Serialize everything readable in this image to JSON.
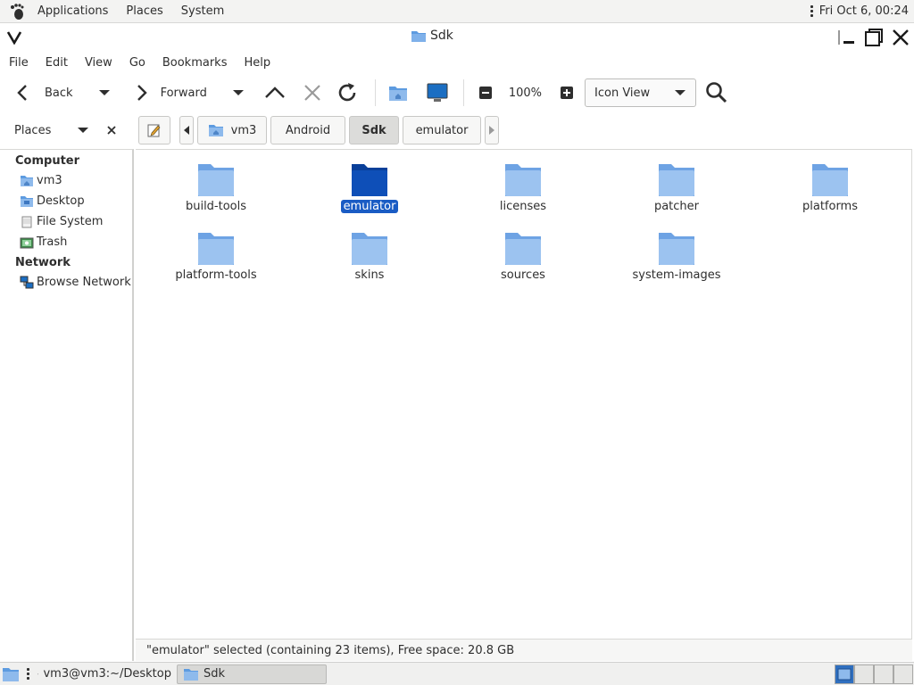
{
  "top_panel": {
    "menus": [
      "Applications",
      "Places",
      "System"
    ],
    "clock": "Fri Oct  6, 00:24"
  },
  "window": {
    "title": "Sdk"
  },
  "menubar": {
    "items": [
      "File",
      "Edit",
      "View",
      "Go",
      "Bookmarks",
      "Help"
    ]
  },
  "toolbar": {
    "back_label": "Back",
    "forward_label": "Forward",
    "zoom_level": "100%",
    "view_mode": "Icon View"
  },
  "location": {
    "places_label": "Places",
    "breadcrumbs": [
      "vm3",
      "Android",
      "Sdk",
      "emulator"
    ],
    "active_crumb": "Sdk"
  },
  "sidebar": {
    "computer_heading": "Computer",
    "computer_items": [
      {
        "label": "vm3",
        "icon": "home-folder-icon"
      },
      {
        "label": "Desktop",
        "icon": "desktop-folder-icon"
      },
      {
        "label": "File System",
        "icon": "drive-icon"
      },
      {
        "label": "Trash",
        "icon": "trash-icon"
      }
    ],
    "network_heading": "Network",
    "network_items": [
      {
        "label": "Browse Network",
        "icon": "network-icon"
      }
    ]
  },
  "files": [
    {
      "name": "build-tools"
    },
    {
      "name": "emulator",
      "selected": true
    },
    {
      "name": "licenses"
    },
    {
      "name": "patcher"
    },
    {
      "name": "platforms"
    },
    {
      "name": "platform-tools"
    },
    {
      "name": "skins"
    },
    {
      "name": "sources"
    },
    {
      "name": "system-images"
    }
  ],
  "statusbar": {
    "text": "\"emulator\" selected (containing 23 items), Free space: 20.8 GB"
  },
  "taskbar": {
    "tasks": [
      {
        "label": "vm3@vm3:~/Desktop",
        "active": false
      },
      {
        "label": "Sdk",
        "active": true
      }
    ]
  },
  "colors": {
    "folder_light": "#8fb8ea",
    "folder_selected": "#0e4fb8",
    "selection": "#1a5cc4"
  }
}
